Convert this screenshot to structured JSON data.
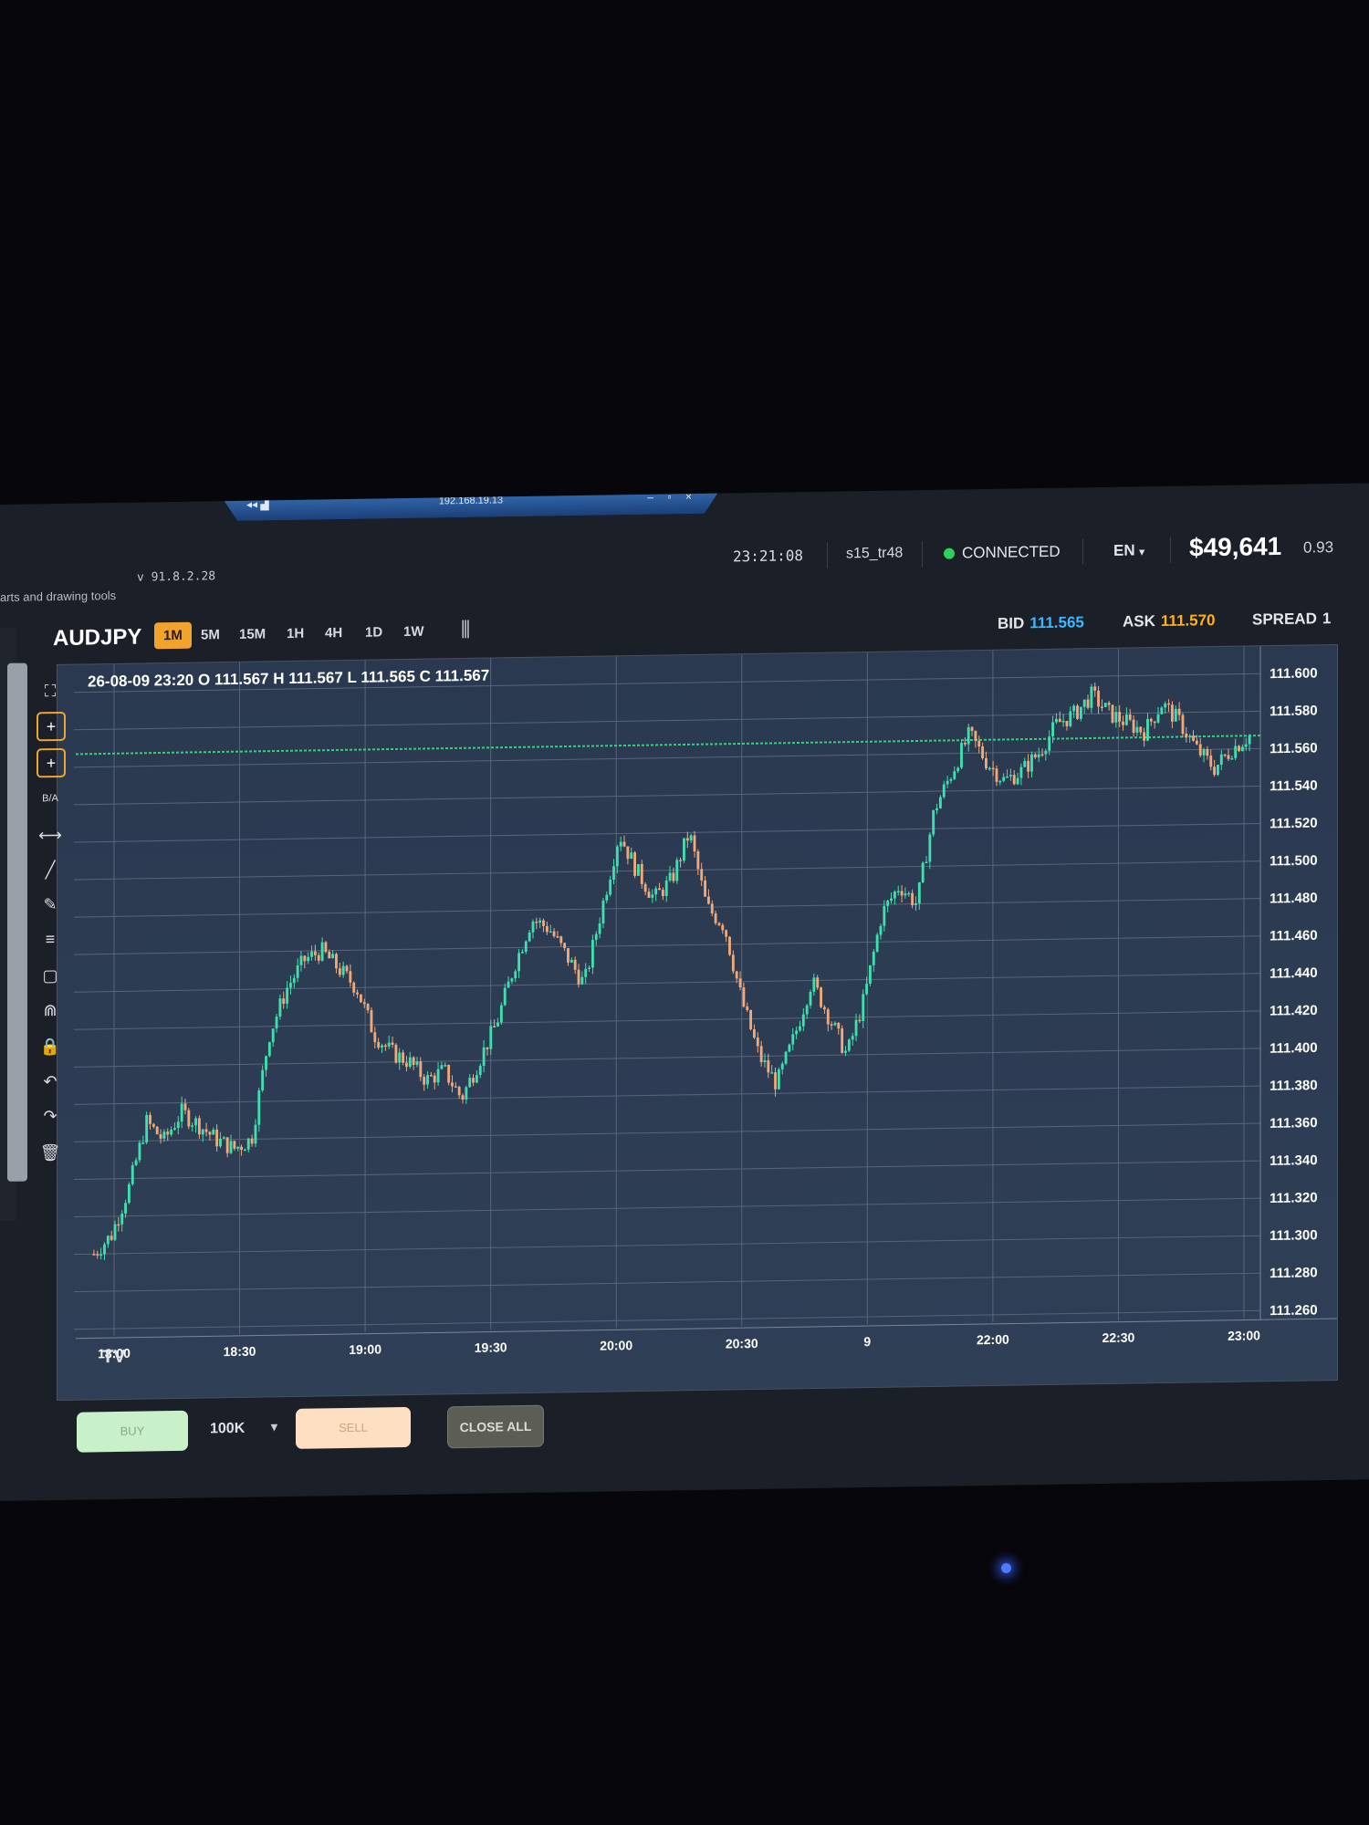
{
  "remote_bar": {
    "ip": "192.168.19.13",
    "pin": "◂◂ ▟",
    "controls": "– ▫ ×"
  },
  "header": {
    "subtitle": "arts and drawing tools",
    "version": "v 91.8.2.28",
    "clock": "23:21:08",
    "user": "s15_tr48",
    "status": "CONNECTED",
    "language": "EN",
    "balance": "$49,641",
    "ratio": "0.93"
  },
  "toolbar": {
    "symbol": "AUDJPY",
    "timeframes": [
      "1M",
      "5M",
      "15M",
      "1H",
      "4H",
      "1D",
      "1W"
    ],
    "active_timeframe": "1M",
    "bid_label": "BID",
    "bid": "111.565",
    "ask_label": "ASK",
    "ask": "111.570",
    "spread_label": "SPREAD",
    "spread": "1"
  },
  "ohlc_text": "26-08-09 23:20 O 111.567 H 111.567 L 111.565 C 111.567",
  "tv_logo": "TV",
  "tools": [
    {
      "name": "fullscreen-icon",
      "glyph": "⛶"
    },
    {
      "name": "crosshair-icon",
      "glyph": "+",
      "active": true
    },
    {
      "name": "crosshair-alt-icon",
      "glyph": "+",
      "active": true
    },
    {
      "name": "bid-ask-icon",
      "glyph": "B/A"
    },
    {
      "name": "horizontal-line-icon",
      "glyph": "⟷"
    },
    {
      "name": "trend-line-icon",
      "glyph": "╱"
    },
    {
      "name": "pencil-icon",
      "glyph": "✎"
    },
    {
      "name": "fib-icon",
      "glyph": "≡"
    },
    {
      "name": "rectangle-icon",
      "glyph": "▢"
    },
    {
      "name": "magnet-icon",
      "glyph": "⋒"
    },
    {
      "name": "lock-icon",
      "glyph": "🔒"
    },
    {
      "name": "undo-icon",
      "glyph": "↶"
    },
    {
      "name": "redo-icon",
      "glyph": "↷"
    },
    {
      "name": "trash-icon",
      "glyph": "🗑"
    }
  ],
  "bottom": {
    "buy": "BUY",
    "lot": "100K",
    "sell": "SELL",
    "close_all": "CLOSE ALL"
  },
  "colors": {
    "up": "#3fe0b0",
    "down": "#f2a97a",
    "accent": "#f2a32c",
    "bid": "#3db8ff",
    "ask": "#ffb020",
    "price_line": "#35d07a"
  },
  "chart_data": {
    "type": "candlestick",
    "x_ticks": [
      "18:00",
      "18:30",
      "19:00",
      "19:30",
      "20:00",
      "20:30",
      "9",
      "22:00",
      "22:30",
      "23:00"
    ],
    "y_ticks": [
      "111.600",
      "111.580",
      "111.560",
      "111.540",
      "111.520",
      "111.500",
      "111.480",
      "111.460",
      "111.440",
      "111.420",
      "111.400",
      "111.380",
      "111.360",
      "111.340",
      "111.320",
      "111.300",
      "111.280",
      "111.260"
    ],
    "ylim": [
      111.26,
      111.6
    ],
    "current_price": 111.567,
    "path": [
      111.3,
      111.31,
      111.335,
      111.37,
      111.36,
      111.375,
      111.368,
      111.36,
      111.355,
      111.36,
      111.415,
      111.44,
      111.455,
      111.46,
      111.45,
      111.44,
      111.415,
      111.405,
      111.4,
      111.39,
      111.395,
      111.38,
      111.4,
      111.42,
      111.45,
      111.475,
      111.47,
      111.455,
      111.44,
      111.48,
      111.52,
      111.5,
      111.485,
      111.495,
      111.52,
      111.48,
      111.47,
      111.43,
      111.4,
      111.385,
      111.41,
      111.44,
      111.42,
      111.4,
      111.43,
      111.475,
      111.49,
      111.48,
      111.53,
      111.55,
      111.57,
      111.555,
      111.545,
      111.55,
      111.56,
      111.575,
      111.58,
      111.59,
      111.58,
      111.575,
      111.57,
      111.585,
      111.575,
      111.56,
      111.55,
      111.56,
      111.567
    ]
  }
}
